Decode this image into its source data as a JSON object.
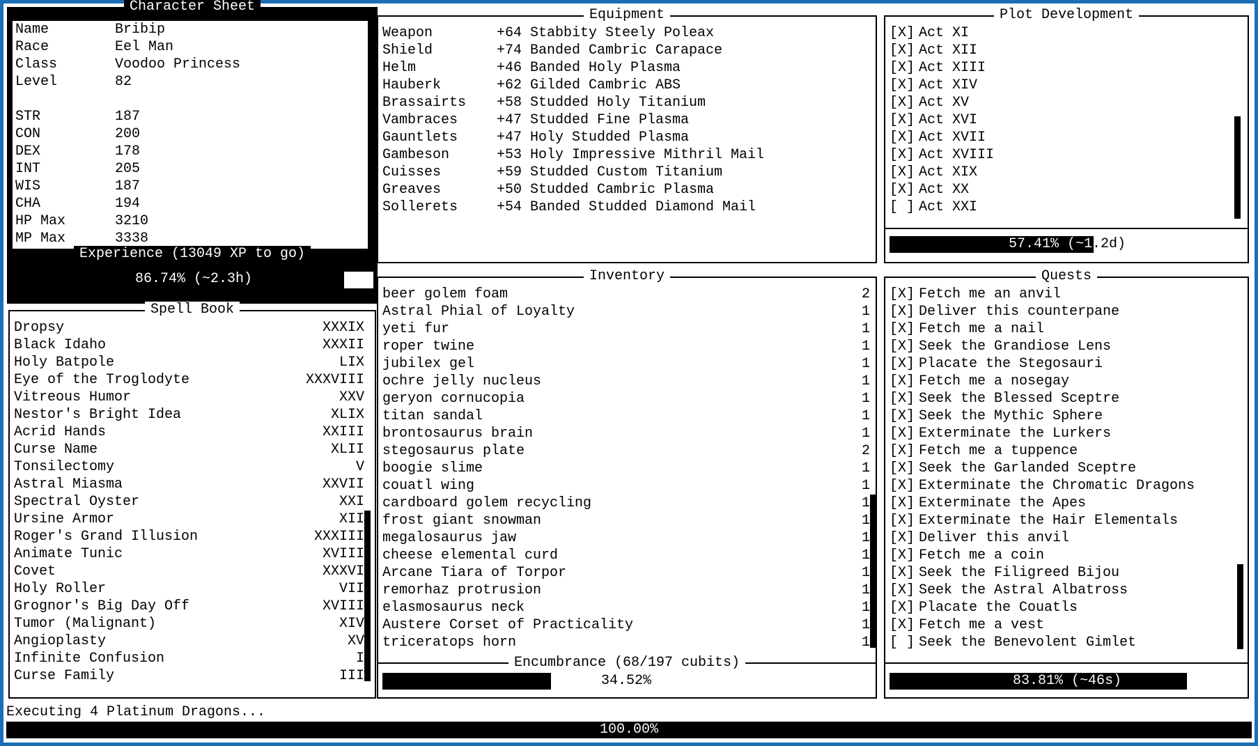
{
  "character_sheet": {
    "title": "Character Sheet",
    "rows": [
      {
        "label": "Name",
        "value": "Bribip"
      },
      {
        "label": "Race",
        "value": "Eel Man"
      },
      {
        "label": "Class",
        "value": "Voodoo Princess"
      },
      {
        "label": "Level",
        "value": "82"
      },
      {
        "label": "",
        "value": ""
      },
      {
        "label": "STR",
        "value": "187"
      },
      {
        "label": "CON",
        "value": "200"
      },
      {
        "label": "DEX",
        "value": "178"
      },
      {
        "label": "INT",
        "value": "205"
      },
      {
        "label": "WIS",
        "value": "187"
      },
      {
        "label": "CHA",
        "value": "194"
      },
      {
        "label": "HP Max",
        "value": "3210"
      },
      {
        "label": "MP Max",
        "value": "3338"
      }
    ],
    "experience_title": "Experience (13049 XP to go)",
    "experience_text": "86.74% (~2.3h)",
    "experience_progress": 0.8674
  },
  "spell_book": {
    "title": "Spell Book",
    "spells": [
      {
        "name": "Dropsy",
        "level": "XXXIX"
      },
      {
        "name": "Black Idaho",
        "level": "XXXII"
      },
      {
        "name": "Holy Batpole",
        "level": "LIX"
      },
      {
        "name": "Eye of the Troglodyte",
        "level": "XXXVIII"
      },
      {
        "name": "Vitreous Humor",
        "level": "XXV"
      },
      {
        "name": "Nestor's Bright Idea",
        "level": "XLIX"
      },
      {
        "name": "Acrid Hands",
        "level": "XXIII"
      },
      {
        "name": "Curse Name",
        "level": "XLII"
      },
      {
        "name": "Tonsilectomy",
        "level": "V"
      },
      {
        "name": "Astral Miasma",
        "level": "XXVII"
      },
      {
        "name": "Spectral Oyster",
        "level": "XXI"
      },
      {
        "name": "Ursine Armor",
        "level": "XII"
      },
      {
        "name": "Roger's Grand Illusion",
        "level": "XXXIII"
      },
      {
        "name": "Animate Tunic",
        "level": "XVIII"
      },
      {
        "name": "Covet",
        "level": "XXXVI"
      },
      {
        "name": "Holy Roller",
        "level": "VII"
      },
      {
        "name": "Grognor's Big Day Off",
        "level": "XVIII"
      },
      {
        "name": "Tumor (Malignant)",
        "level": "XIV"
      },
      {
        "name": "Angioplasty",
        "level": "XV"
      },
      {
        "name": "Infinite Confusion",
        "level": "I"
      },
      {
        "name": "Curse Family",
        "level": "III"
      }
    ]
  },
  "equipment": {
    "title": "Equipment",
    "items": [
      {
        "slot": "Weapon",
        "item": "+64 Stabbity Steely Poleax"
      },
      {
        "slot": "Shield",
        "item": "+74 Banded Cambric Carapace"
      },
      {
        "slot": "Helm",
        "item": "+46 Banded Holy Plasma"
      },
      {
        "slot": "Hauberk",
        "item": "+62 Gilded Cambric ABS"
      },
      {
        "slot": "Brassairts",
        "item": "+58 Studded Holy Titanium"
      },
      {
        "slot": "Vambraces",
        "item": "+47 Studded Fine Plasma"
      },
      {
        "slot": "Gauntlets",
        "item": "+47 Holy Studded Plasma"
      },
      {
        "slot": "Gambeson",
        "item": "+53 Holy Impressive Mithril Mail"
      },
      {
        "slot": "Cuisses",
        "item": "+59 Studded Custom Titanium"
      },
      {
        "slot": "Greaves",
        "item": "+50 Studded Cambric Plasma"
      },
      {
        "slot": "Sollerets",
        "item": "+54 Banded Studded Diamond Mail"
      }
    ]
  },
  "inventory": {
    "title": "Inventory",
    "items": [
      {
        "name": "beer golem foam",
        "qty": "2"
      },
      {
        "name": "Astral Phial of Loyalty",
        "qty": "1"
      },
      {
        "name": "yeti fur",
        "qty": "1"
      },
      {
        "name": "roper twine",
        "qty": "1"
      },
      {
        "name": "jubilex gel",
        "qty": "1"
      },
      {
        "name": "ochre jelly nucleus",
        "qty": "1"
      },
      {
        "name": "geryon cornucopia",
        "qty": "1"
      },
      {
        "name": "titan sandal",
        "qty": "1"
      },
      {
        "name": "brontosaurus brain",
        "qty": "1"
      },
      {
        "name": "stegosaurus plate",
        "qty": "2"
      },
      {
        "name": "boogie slime",
        "qty": "1"
      },
      {
        "name": "couatl wing",
        "qty": "1"
      },
      {
        "name": "cardboard golem recycling",
        "qty": "1"
      },
      {
        "name": "frost giant snowman",
        "qty": "1"
      },
      {
        "name": "megalosaurus jaw",
        "qty": "1"
      },
      {
        "name": "cheese elemental curd",
        "qty": "1"
      },
      {
        "name": "Arcane Tiara of Torpor",
        "qty": "1"
      },
      {
        "name": "remorhaz protrusion",
        "qty": "1"
      },
      {
        "name": "elasmosaurus neck",
        "qty": "1"
      },
      {
        "name": "Austere Corset of Practicality",
        "qty": "1"
      },
      {
        "name": "triceratops horn",
        "qty": "1"
      }
    ],
    "encumbrance_title": "Encumbrance (68/197 cubits)",
    "encumbrance_text": "34.52%",
    "encumbrance_progress": 0.3452
  },
  "plot": {
    "title": "Plot Development",
    "acts": [
      {
        "check": "[X]",
        "name": "Act XI"
      },
      {
        "check": "[X]",
        "name": "Act XII"
      },
      {
        "check": "[X]",
        "name": "Act XIII"
      },
      {
        "check": "[X]",
        "name": "Act XIV"
      },
      {
        "check": "[X]",
        "name": "Act XV"
      },
      {
        "check": "[X]",
        "name": "Act XVI"
      },
      {
        "check": "[X]",
        "name": "Act XVII"
      },
      {
        "check": "[X]",
        "name": "Act XVIII"
      },
      {
        "check": "[X]",
        "name": "Act XIX"
      },
      {
        "check": "[X]",
        "name": "Act XX"
      },
      {
        "check": "[ ]",
        "name": "Act XXI"
      }
    ],
    "progress_text": "57.41% (~1.2d)",
    "progress": 0.5741
  },
  "quests": {
    "title": "Quests",
    "items": [
      {
        "check": "[X]",
        "name": "Fetch me an anvil"
      },
      {
        "check": "[X]",
        "name": "Deliver this counterpane"
      },
      {
        "check": "[X]",
        "name": "Fetch me a nail"
      },
      {
        "check": "[X]",
        "name": "Seek the Grandiose Lens"
      },
      {
        "check": "[X]",
        "name": "Placate the Stegosauri"
      },
      {
        "check": "[X]",
        "name": "Fetch me a nosegay"
      },
      {
        "check": "[X]",
        "name": "Seek the Blessed Sceptre"
      },
      {
        "check": "[X]",
        "name": "Seek the Mythic Sphere"
      },
      {
        "check": "[X]",
        "name": "Exterminate the Lurkers"
      },
      {
        "check": "[X]",
        "name": "Fetch me a tuppence"
      },
      {
        "check": "[X]",
        "name": "Seek the Garlanded Sceptre"
      },
      {
        "check": "[X]",
        "name": "Exterminate the Chromatic Dragons"
      },
      {
        "check": "[X]",
        "name": "Exterminate the Apes"
      },
      {
        "check": "[X]",
        "name": "Exterminate the Hair Elementals"
      },
      {
        "check": "[X]",
        "name": "Deliver this anvil"
      },
      {
        "check": "[X]",
        "name": "Fetch me a coin"
      },
      {
        "check": "[X]",
        "name": "Seek the Filigreed Bijou"
      },
      {
        "check": "[X]",
        "name": "Seek the Astral Albatross"
      },
      {
        "check": "[X]",
        "name": "Placate the Couatls"
      },
      {
        "check": "[X]",
        "name": "Fetch me a vest"
      },
      {
        "check": "[ ]",
        "name": "Seek the Benevolent Gimlet"
      }
    ],
    "progress_text": "83.81% (~46s)",
    "progress": 0.8381
  },
  "status": {
    "text": "Executing 4 Platinum Dragons...",
    "progress_text": "100.00%",
    "progress": 1.0
  },
  "colors": {
    "frame": "#1a6fb5",
    "background": "#ffffff",
    "foreground": "#000000"
  }
}
